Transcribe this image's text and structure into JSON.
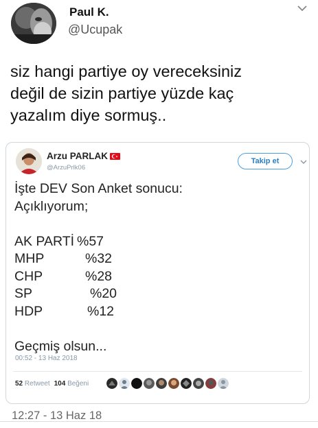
{
  "author": {
    "name": "Paul K.",
    "handle": "@Ucupak"
  },
  "tweet": {
    "text": "siz hangi partiye oy vereceksiniz\ndeğil de sizin partiye yüzde kaç\nyazalım diye sormuş..",
    "timestamp": "12:27 - 13 Haz 18"
  },
  "quoted": {
    "name": "Arzu PARLAK",
    "handle": "@ArzuPrlk06",
    "follow_label": "Takip et",
    "intro_line1": "İşte DEV Son Anket sonucu:",
    "intro_line2": "Açıklıyorum;",
    "results": [
      {
        "party": "AK PARTİ",
        "value": "%57"
      },
      {
        "party": "MHP",
        "value": "%32"
      },
      {
        "party": "CHP",
        "value": "%28"
      },
      {
        "party": "SP",
        "value": "%20"
      },
      {
        "party": "HDP",
        "value": "%12"
      }
    ],
    "closing": "Geçmiş olsun...",
    "timestamp": "00:52 - 13 Haz 2018",
    "retweets_count": "52",
    "retweets_label": "Retweet",
    "likes_count": "104",
    "likes_label": "Beğeni",
    "liker_icons": [
      "avatar",
      "avatar",
      "avatar",
      "avatar",
      "avatar",
      "avatar",
      "avatar",
      "avatar",
      "avatar",
      "avatar"
    ]
  },
  "colors": {
    "link_blue": "#2c7fc0",
    "muted": "#8899a6",
    "flag_red": "#e30a17"
  }
}
